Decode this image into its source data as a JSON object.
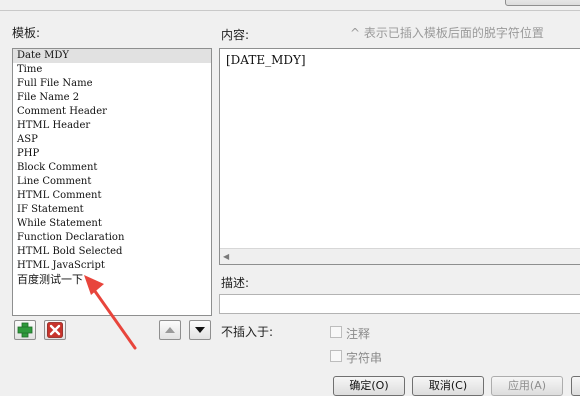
{
  "labels": {
    "templates": "模板:",
    "content": "内容:",
    "hint": "^ 表示已插入模板后面的脱字符位置",
    "description": "描述:",
    "not_insert_into": "不插入于:"
  },
  "templates": [
    "Date MDY",
    "Time",
    "Full File Name",
    "File Name 2",
    "Comment Header",
    "HTML Header",
    "ASP",
    "PHP",
    "Block Comment",
    "Line Comment",
    "HTML Comment",
    "IF Statement",
    "While Statement",
    "Function Declaration",
    "HTML Bold Selected",
    "HTML JavaScript",
    "百度测试一下"
  ],
  "selected_index": 0,
  "editor": {
    "content": "[DATE_MDY]"
  },
  "description_value": "",
  "checkboxes": [
    {
      "label": "注释",
      "checked": false,
      "enabled": false
    },
    {
      "label": "字符串",
      "checked": false,
      "enabled": false
    }
  ],
  "buttons": {
    "ok": "确定(O)",
    "cancel": "取消(C)",
    "apply": "应用(A)"
  },
  "icons": {
    "add": "add-icon",
    "delete": "delete-icon",
    "move_up": "arrow-up-icon",
    "move_down": "arrow-down-icon"
  },
  "colors": {
    "add_green": "#2f9a3c",
    "delete_red": "#c8342c",
    "annotation_arrow": "#e8453c"
  }
}
